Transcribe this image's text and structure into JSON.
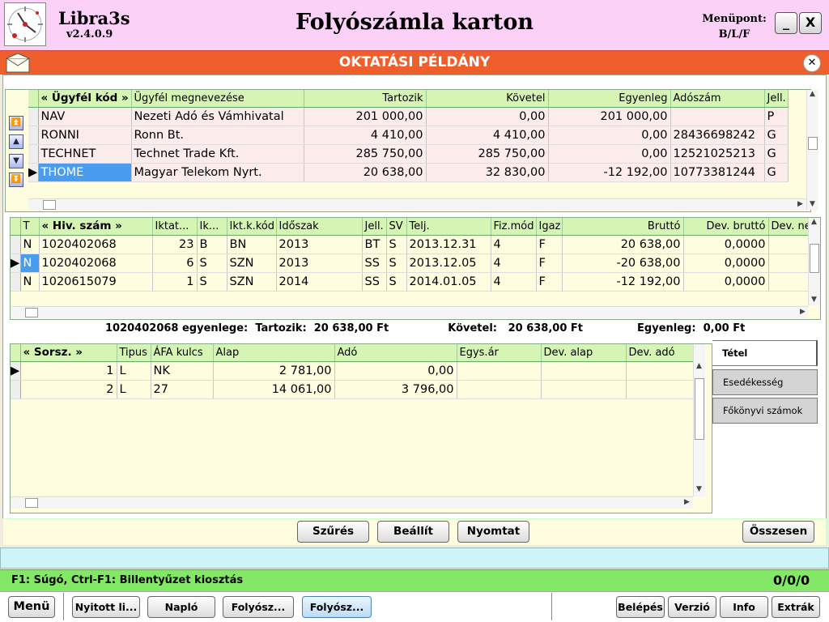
{
  "app": {
    "name": "Libra3s",
    "version": "v2.4.0.9",
    "title": "Folyószámla karton",
    "menupont_label": "Menüpont:",
    "menupont_value": "B/L/F",
    "minimize": "_",
    "close": "X"
  },
  "banner": {
    "title": "OKTATÁSI PÉLDÁNY",
    "close": "✕"
  },
  "customers": {
    "columns": [
      "« Ügyfél kód »",
      "Ügyfél megnevezése",
      "Tartozik",
      "Követel",
      "Egyenleg",
      "Adószám",
      "Jell."
    ],
    "rows": [
      [
        "NAV",
        "Nezeti Adó és Vámhivatal",
        "201 000,00",
        "0,00",
        "201 000,00",
        "",
        "P"
      ],
      [
        "RONNI",
        "Ronn Bt.",
        "4 410,00",
        "4 410,00",
        "0,00",
        "28436698242",
        "G"
      ],
      [
        "TECHNET",
        "Technet Trade Kft.",
        "285 750,00",
        "285 750,00",
        "0,00",
        "12521025213",
        "G"
      ],
      [
        "THOME",
        "Magyar Telekom Nyrt.",
        "20 638,00",
        "32 830,00",
        "-12 192,00",
        "10773381244",
        "G"
      ]
    ]
  },
  "invoices": {
    "columns": [
      "T",
      "« Hiv. szám »",
      "Iktat...",
      "Ik...",
      "Ikt.k.kód",
      "Időszak",
      "Jell.",
      "SV",
      "Telj.",
      "Fiz.mód",
      "Igaz",
      "Bruttó",
      "Dev. bruttó",
      "Dev. ne"
    ],
    "rows": [
      [
        "N",
        "1020402068",
        "23",
        "B",
        "BN",
        "2013",
        "BT",
        "S",
        "2013.12.31",
        "4",
        "F",
        "20 638,00",
        "0,0000",
        ""
      ],
      [
        "N",
        "1020402068",
        "6",
        "S",
        "SZN",
        "2013",
        "SS",
        "S",
        "2013.12.05",
        "4",
        "F",
        "-20 638,00",
        "0,0000",
        ""
      ],
      [
        "N",
        "1020615079",
        "1",
        "S",
        "SZN",
        "2014",
        "SS",
        "S",
        "2014.01.05",
        "4",
        "F",
        "-12 192,00",
        "0,0000",
        ""
      ]
    ]
  },
  "balance": {
    "label": "1020402068 egyenlege:",
    "tartozik_label": "Tartozik:",
    "tartozik": "20 638,00 Ft",
    "kovetel_label": "Követel:",
    "kovetel": "20 638,00 Ft",
    "egyenleg_label": "Egyenleg:",
    "egyenleg": "0,00 Ft"
  },
  "items": {
    "columns": [
      "« Sorsz. »",
      "Tipus",
      "ÁFA kulcs",
      "Alap",
      "Adó",
      "Egys.ár",
      "Dev. alap",
      "Dev. adó"
    ],
    "rows": [
      [
        "1",
        "L",
        "NK",
        "2 781,00",
        "0,00",
        "",
        "",
        ""
      ],
      [
        "2",
        "L",
        "27",
        "14 061,00",
        "3 796,00",
        "",
        "",
        ""
      ]
    ]
  },
  "tabs": [
    "Tétel",
    "Esedékesség",
    "Főkönyvi számok"
  ],
  "actions": [
    "Szűrés",
    "Beállít",
    "Nyomtat",
    "Összesen"
  ],
  "status": {
    "help": "F1: Súgó, Ctrl-F1: Billentyűzet kiosztás",
    "count": "0/0/0"
  },
  "taskbar": {
    "left": [
      "Menü",
      "Nyitott li...",
      "Napló",
      "Folyósz...",
      "Folyósz..."
    ],
    "right": [
      "Belépés",
      "Verzió",
      "Info",
      "Extrák"
    ]
  }
}
